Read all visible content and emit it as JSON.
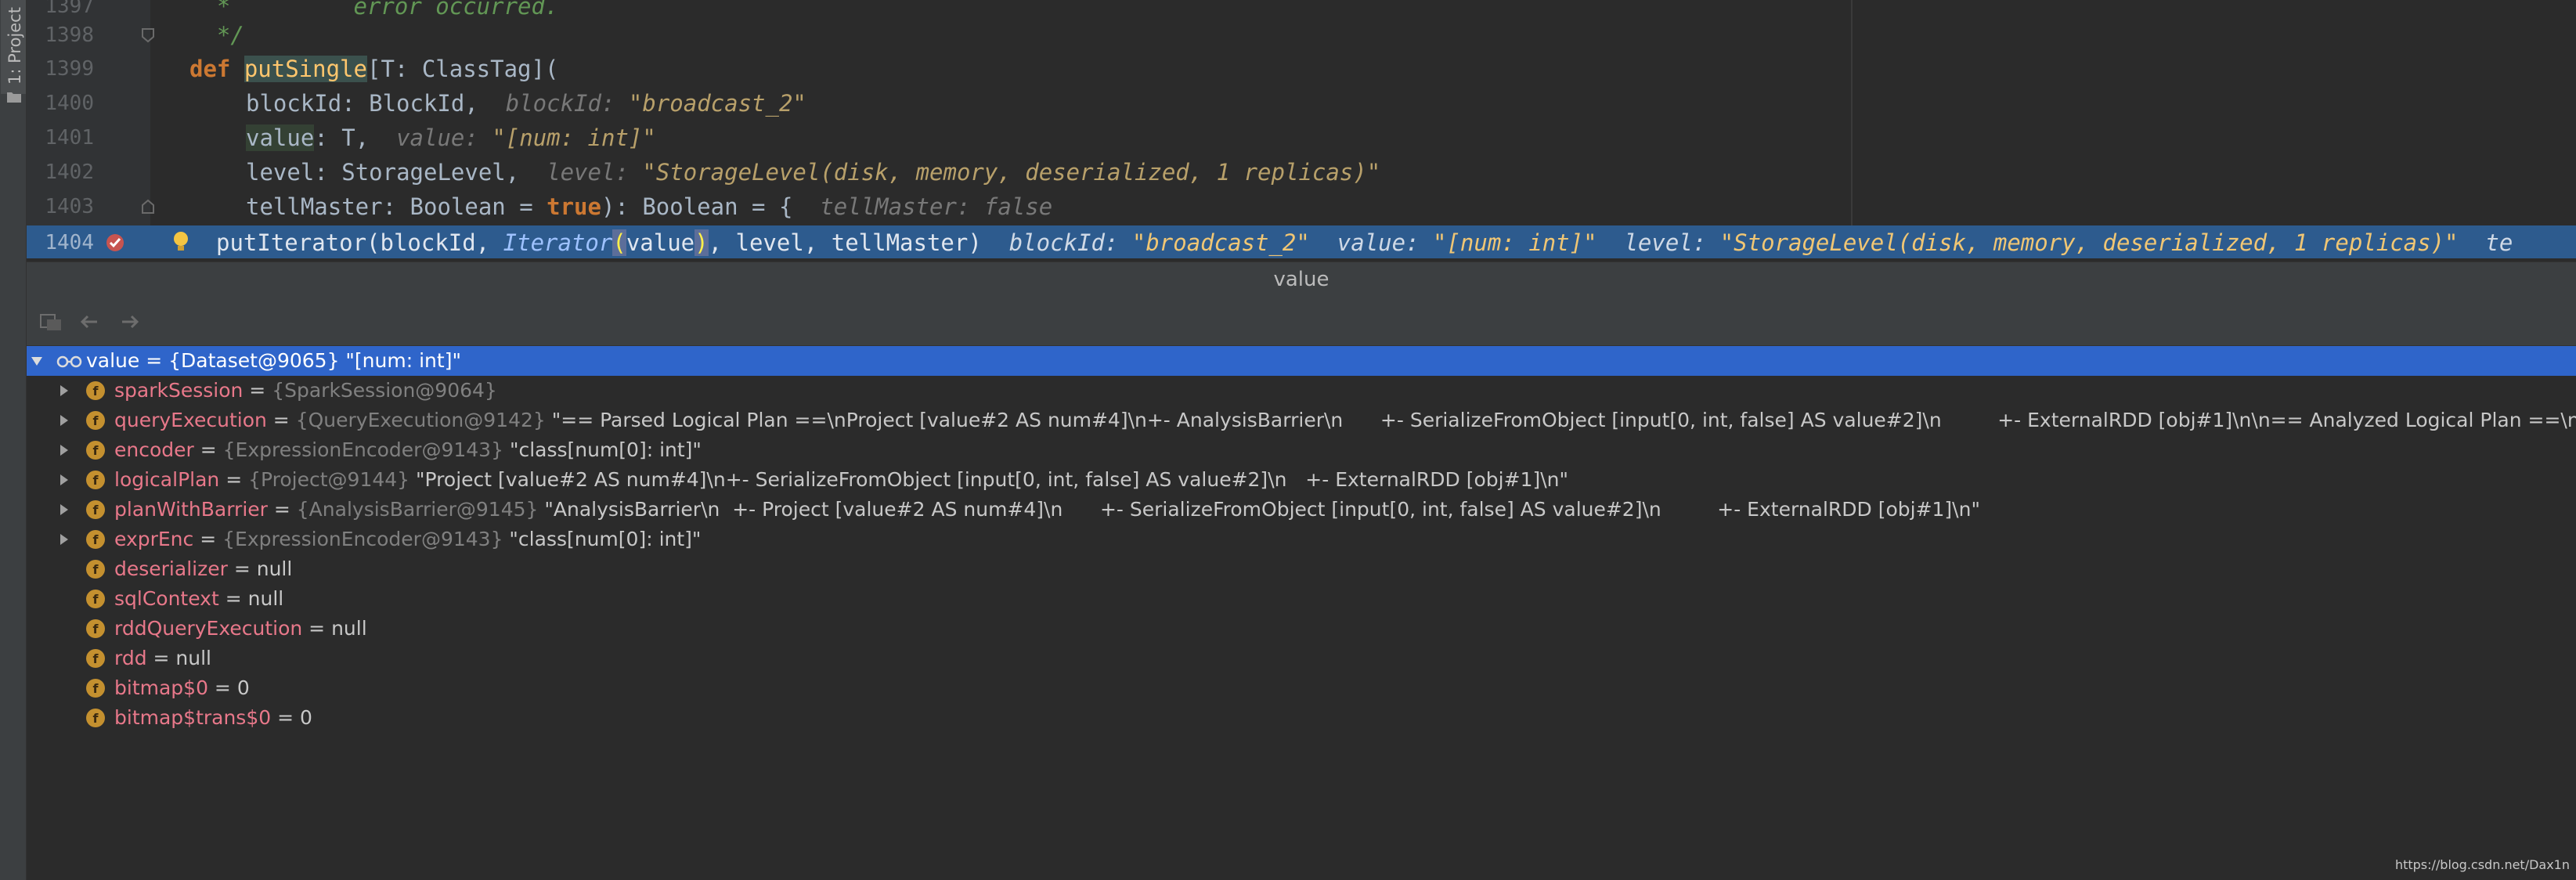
{
  "tool_window_tab": "1: Project",
  "editor": {
    "lines": [
      {
        "num": "1397",
        "text": "  *         error occurred."
      },
      {
        "num": "1398",
        "text": "  */"
      },
      {
        "num": "1399",
        "kw": "def ",
        "fn": "putSingle",
        "rest": "[T: ClassTag]("
      },
      {
        "num": "1400",
        "param": "blockId",
        "type": ": BlockId,",
        "hint_label": "blockId:",
        "hint_val": "\"broadcast_2\""
      },
      {
        "num": "1401",
        "param": "value",
        "type": ": T,",
        "hint_label": "value:",
        "hint_val": "\"[num: int]\""
      },
      {
        "num": "1402",
        "param": "level",
        "type": ": StorageLevel,",
        "hint_label": "level:",
        "hint_val": "\"StorageLevel(disk, memory, deserialized, 1 replicas)\""
      },
      {
        "num": "1403",
        "param": "tellMaster",
        "type": ": Boolean = ",
        "kw2": "true",
        "type2": "): Boolean = {",
        "hint_label": "tellMaster:",
        "hint_val": "false"
      },
      {
        "num": "1404"
      }
    ],
    "exec_line": {
      "call": "putIterator(blockId, ",
      "iter": "Iterator",
      "arg": "value",
      "tail": ", level, tellMaster)",
      "h1_label": "blockId:",
      "h1_val": "\"broadcast_2\"",
      "h2_label": "value:",
      "h2_val": "\"[num: int]\"",
      "h3_label": "level:",
      "h3_val": "\"StorageLevel(disk, memory, deserialized, 1 replicas)\"",
      "h4_label": "te"
    }
  },
  "debugger": {
    "title": "value",
    "toolbar_icons": [
      "frames-icon",
      "back-arrow-icon",
      "forward-arrow-icon"
    ],
    "root": {
      "name": "value",
      "eq": " = ",
      "ref": "{Dataset@9065}",
      "value": " \"[num: int]\""
    },
    "fields": [
      {
        "name": "sparkSession",
        "ref": "{SparkSession@9064}",
        "value": "",
        "expandable": true
      },
      {
        "name": "queryExecution",
        "ref": "{QueryExecution@9142}",
        "value": " \"== Parsed Logical Plan ==\\nProject [value#2 AS num#4]\\n+- AnalysisBarrier\\n      +- SerializeFromObject [input[0, int, false] AS value#2]\\n         +- ExternalRDD [obj#1]\\n\\n== Analyzed Logical Plan ==\\nnum: int...",
        "expandable": true
      },
      {
        "name": "encoder",
        "ref": "{ExpressionEncoder@9143}",
        "value": " \"class[num[0]: int]\"",
        "expandable": true
      },
      {
        "name": "logicalPlan",
        "ref": "{Project@9144}",
        "value": " \"Project [value#2 AS num#4]\\n+- SerializeFromObject [input[0, int, false] AS value#2]\\n   +- ExternalRDD [obj#1]\\n\"",
        "expandable": true
      },
      {
        "name": "planWithBarrier",
        "ref": "{AnalysisBarrier@9145}",
        "value": " \"AnalysisBarrier\\n  +- Project [value#2 AS num#4]\\n      +- SerializeFromObject [input[0, int, false] AS value#2]\\n         +- ExternalRDD [obj#1]\\n\"",
        "expandable": true
      },
      {
        "name": "exprEnc",
        "ref": "{ExpressionEncoder@9143}",
        "value": " \"class[num[0]: int]\"",
        "expandable": true
      },
      {
        "name": "deserializer",
        "ref": "",
        "value": "null",
        "expandable": false
      },
      {
        "name": "sqlContext",
        "ref": "",
        "value": "null",
        "expandable": false
      },
      {
        "name": "rddQueryExecution",
        "ref": "",
        "value": "null",
        "expandable": false
      },
      {
        "name": "rdd",
        "ref": "",
        "value": "null",
        "expandable": false
      },
      {
        "name": "bitmap$0",
        "ref": "",
        "value": "0",
        "expandable": false
      },
      {
        "name": "bitmap$trans$0",
        "ref": "",
        "value": "0",
        "expandable": false
      }
    ]
  },
  "watermark": "https://blog.csdn.net/Dax1n",
  "colors": {
    "selection": "#2f65ca",
    "exec_line": "#2d5b8e",
    "field_name": "#e8788a",
    "keyword": "#cc7832"
  }
}
